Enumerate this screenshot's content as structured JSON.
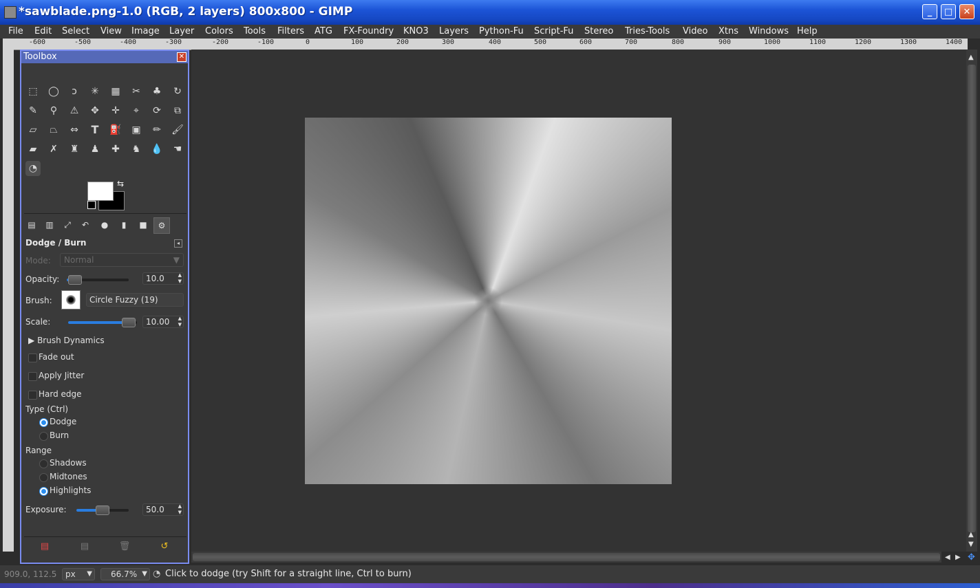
{
  "window": {
    "title": "*sawblade.png-1.0 (RGB, 2 layers) 800x800 - GIMP",
    "minimize": "_",
    "maximize": "□",
    "close": "✕"
  },
  "menu": [
    "File",
    "Edit",
    "Select",
    "View",
    "Image",
    "Layer",
    "Colors",
    "Tools",
    "Filters",
    "ATG",
    "FX-Foundry",
    "KNO3",
    "Layers",
    "Python-Fu",
    "Script-Fu",
    "Stereo",
    "Tries-Tools",
    "Video",
    "Xtns",
    "Windows",
    "Help"
  ],
  "ruler": [
    "-600",
    "-500",
    "-400",
    "-300",
    "-200",
    "-100",
    "0",
    "100",
    "200",
    "300",
    "400",
    "500",
    "600",
    "700",
    "800",
    "900",
    "1000",
    "1100",
    "1200",
    "1300",
    "1400"
  ],
  "toolbox": {
    "title": "Toolbox",
    "close": "✕",
    "tool_options": {
      "title": "Dodge / Burn",
      "mode_label": "Mode:",
      "mode_value": "Normal",
      "opacity_label": "Opacity:",
      "opacity_value": "10.0",
      "brush_label": "Brush:",
      "brush_value": "Circle Fuzzy (19)",
      "scale_label": "Scale:",
      "scale_value": "10.00",
      "brush_dynamics": "Brush Dynamics",
      "fade_out": "Fade out",
      "apply_jitter": "Apply Jitter",
      "hard_edge": "Hard edge",
      "type_label": "Type  (Ctrl)",
      "type_dodge": "Dodge",
      "type_burn": "Burn",
      "range_label": "Range",
      "range_shadows": "Shadows",
      "range_midtones": "Midtones",
      "range_highlights": "Highlights",
      "exposure_label": "Exposure:",
      "exposure_value": "50.0"
    }
  },
  "status": {
    "coords": "909.0, 112.5",
    "unit": "px",
    "zoom": "66.7%",
    "message": "Click to dodge (try Shift for a straight line, Ctrl to burn)"
  }
}
